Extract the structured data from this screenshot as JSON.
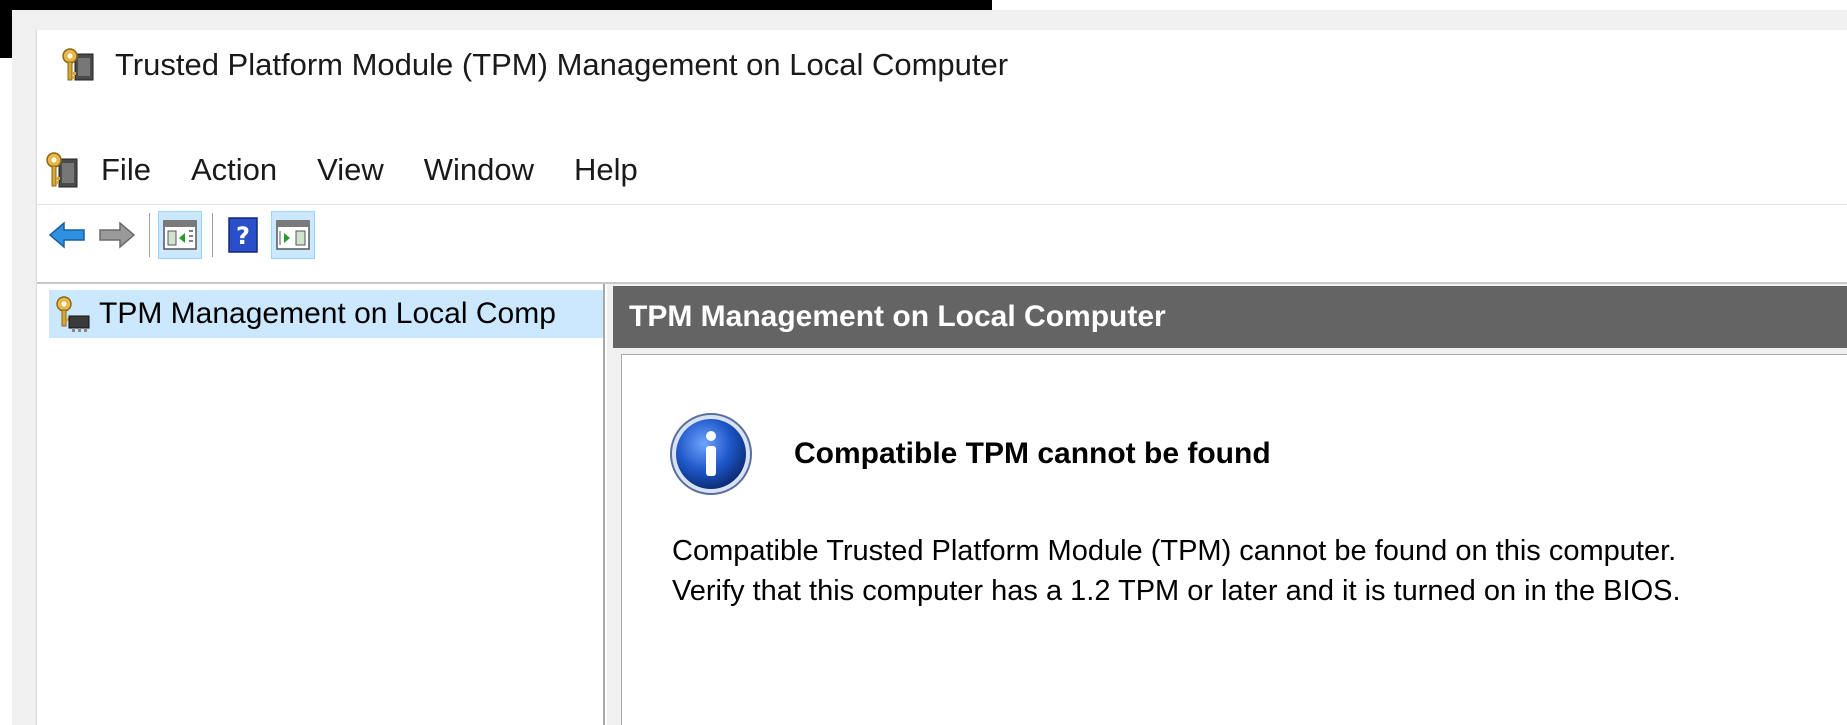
{
  "window": {
    "title": "Trusted Platform Module (TPM) Management on Local Computer"
  },
  "menubar": {
    "items": [
      "File",
      "Action",
      "View",
      "Window",
      "Help"
    ]
  },
  "toolbar": {
    "buttons": [
      "back-arrow-icon",
      "forward-arrow-icon",
      "show-hide-console-tree-icon",
      "help-icon",
      "show-hide-action-pane-icon"
    ]
  },
  "tree": {
    "root_label": "TPM Management on Local Comp"
  },
  "content": {
    "header": "TPM Management on Local Computer",
    "status_title": "Compatible TPM cannot be found",
    "status_message": "Compatible Trusted Platform Module (TPM) cannot be found on this computer. Verify that this computer has a 1.2 TPM or later and it is turned on in the BIOS."
  },
  "colors": {
    "selection": "#cce8ff",
    "header_bg": "#646464",
    "info_blue": "#1e56c8"
  }
}
